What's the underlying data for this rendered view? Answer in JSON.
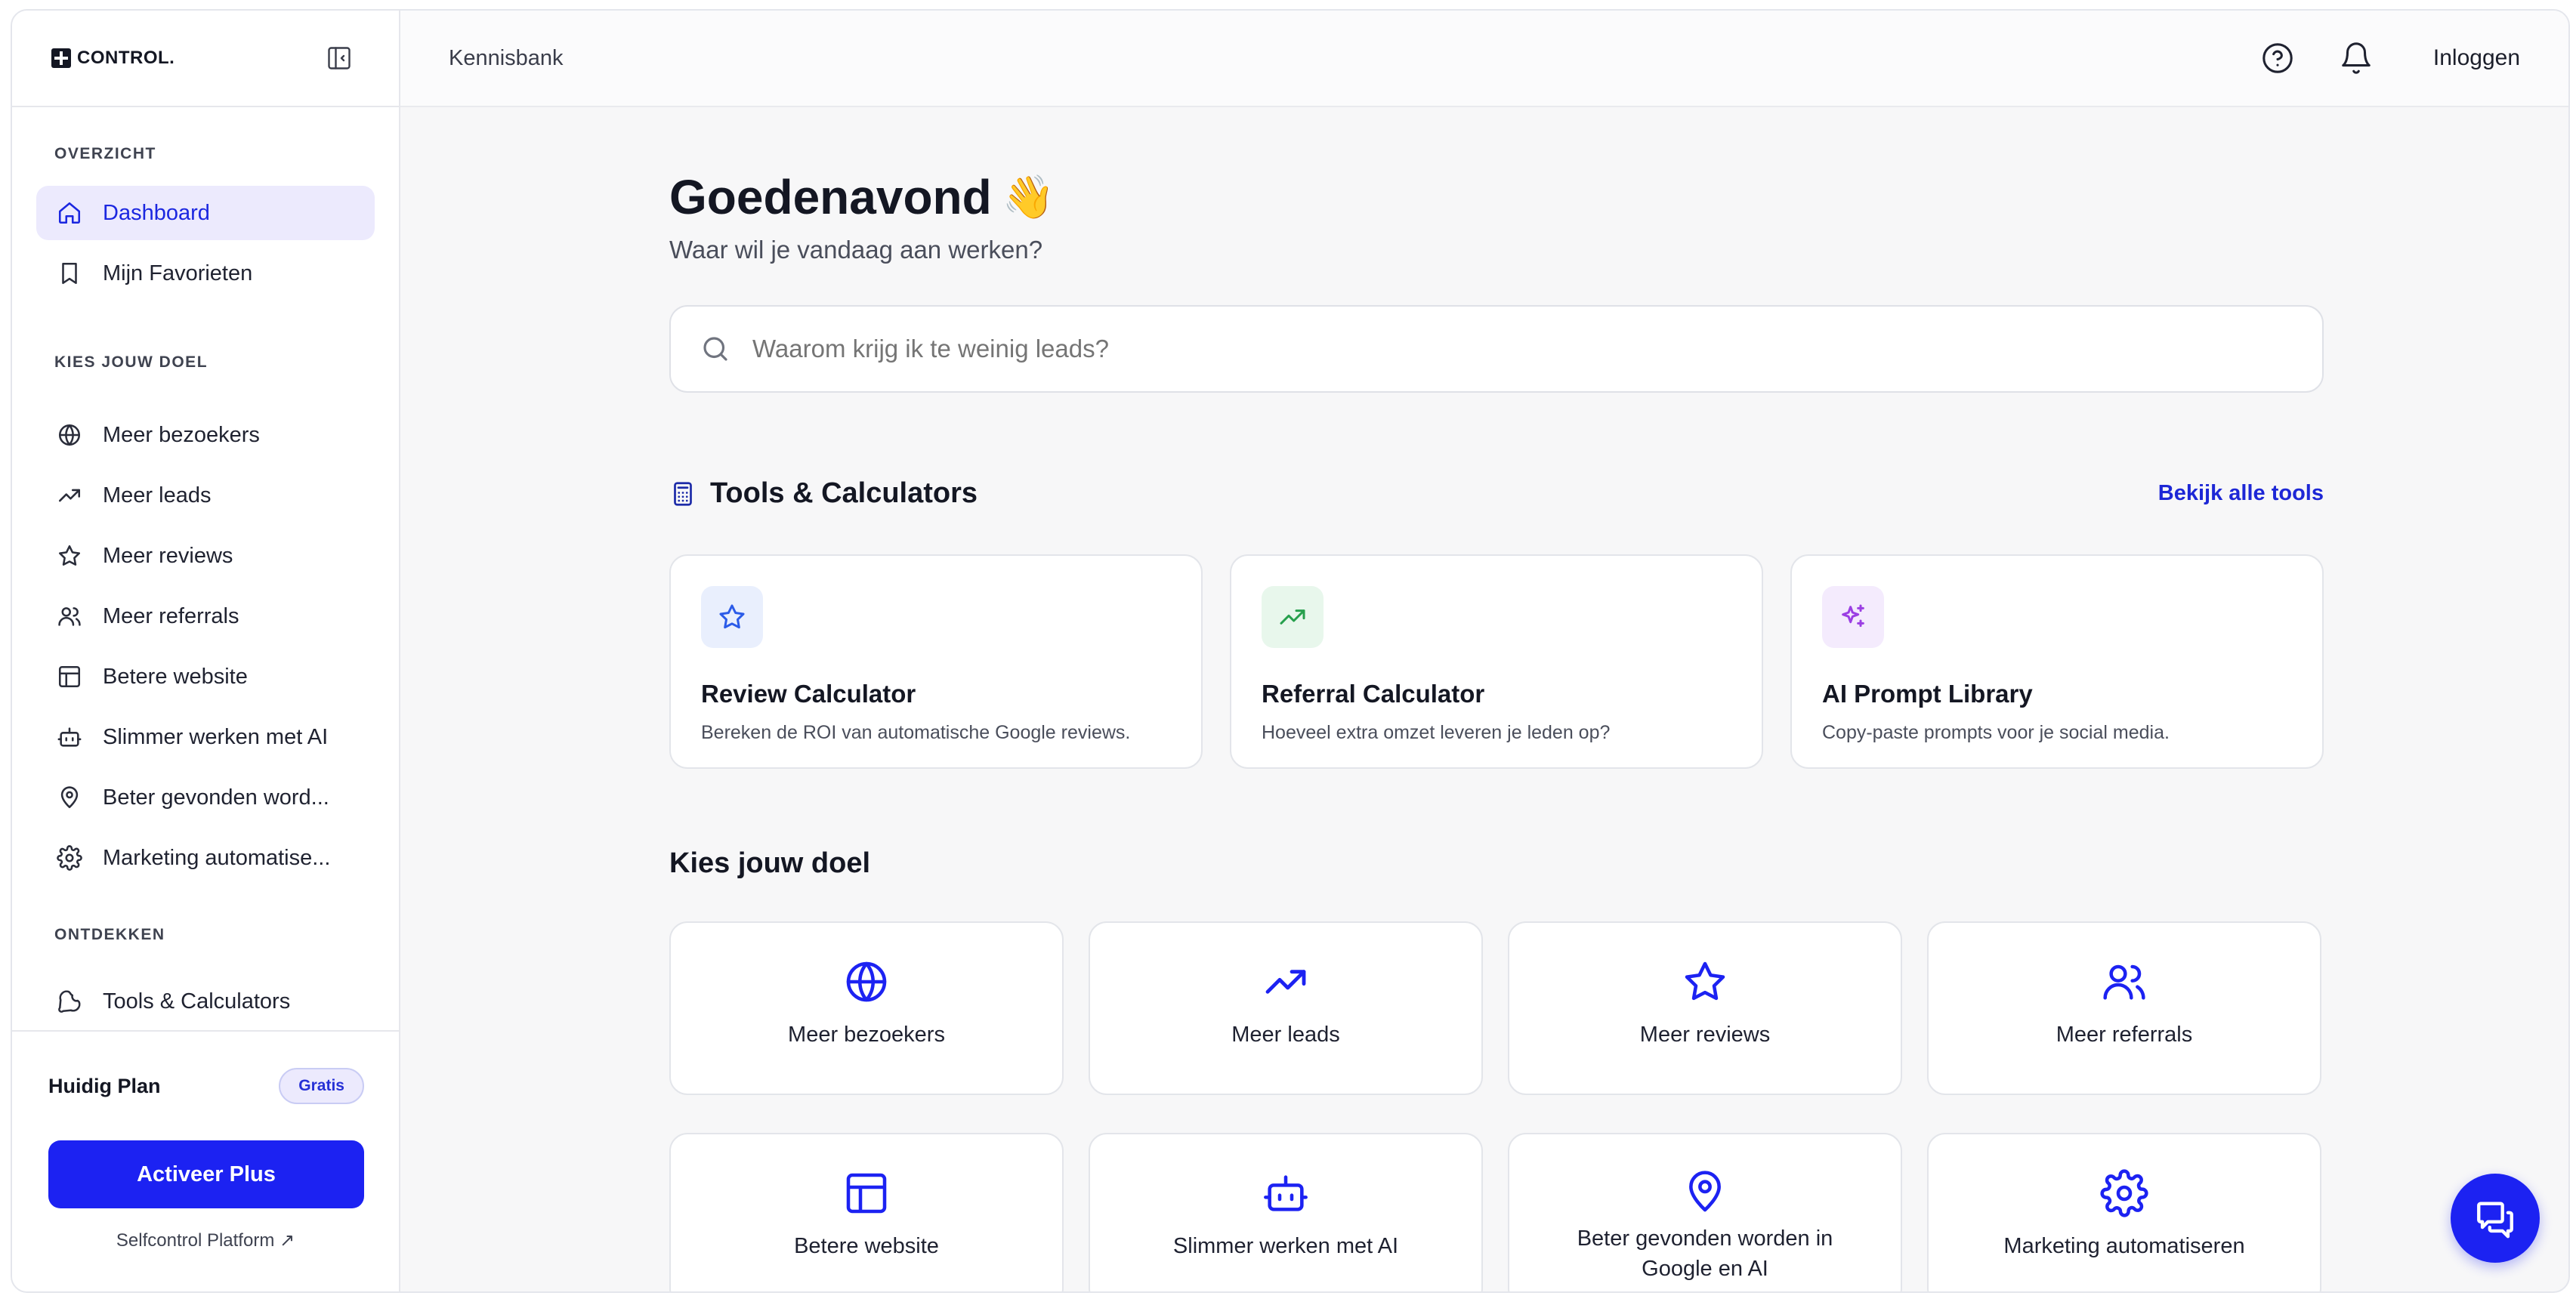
{
  "brand": {
    "name": "CONTROL."
  },
  "header": {
    "breadcrumb": "Kennisbank",
    "login_label": "Inloggen"
  },
  "sidebar": {
    "sections": {
      "overview": "OVERZICHT",
      "goals": "KIES JOUW DOEL",
      "discover": "ONTDEKKEN"
    },
    "items": {
      "dashboard": "Dashboard",
      "favorites": "Mijn Favorieten",
      "visitors": "Meer bezoekers",
      "leads": "Meer leads",
      "reviews": "Meer reviews",
      "referrals": "Meer referrals",
      "website": "Betere website",
      "ai": "Slimmer werken met AI",
      "found": "Beter gevonden word...",
      "automation": "Marketing automatise...",
      "tools": "Tools & Calculators"
    },
    "plan": {
      "label": "Huidig Plan",
      "badge": "Gratis"
    },
    "cta_label": "Activeer Plus",
    "platform_link": "Selfcontrol Platform ↗"
  },
  "main": {
    "greeting": "Goedenavond",
    "greeting_emoji": "👋",
    "subtitle": "Waar wil je vandaag aan werken?",
    "search": {
      "placeholder": "Waarom krijg ik te weinig leads?"
    },
    "tools_section": {
      "title": "Tools & Calculators",
      "see_all": "Bekijk alle tools",
      "cards": [
        {
          "title": "Review Calculator",
          "desc": "Bereken de ROI van automatische Google reviews.",
          "icon": "star-icon",
          "bg": "#e9effd",
          "color": "#2b5be8"
        },
        {
          "title": "Referral Calculator",
          "desc": "Hoeveel extra omzet leveren je leden op?",
          "icon": "trending-up-icon",
          "bg": "#e8f7ec",
          "color": "#27a04d"
        },
        {
          "title": "AI Prompt Library",
          "desc": "Copy-paste prompts voor je social media.",
          "icon": "sparkles-icon",
          "bg": "#f4ebfd",
          "color": "#9b3fe3"
        }
      ]
    },
    "goals_section": {
      "title": "Kies jouw doel",
      "cards": [
        {
          "label": "Meer bezoekers",
          "icon": "globe-icon"
        },
        {
          "label": "Meer leads",
          "icon": "trending-up-icon"
        },
        {
          "label": "Meer reviews",
          "icon": "star-icon"
        },
        {
          "label": "Meer referrals",
          "icon": "users-icon"
        },
        {
          "label": "Betere website",
          "icon": "layout-icon"
        },
        {
          "label": "Slimmer werken met AI",
          "icon": "bot-icon"
        },
        {
          "label": "Beter gevonden worden in Google en AI",
          "icon": "map-pin-icon"
        },
        {
          "label": "Marketing automatiseren",
          "icon": "gear-icon"
        }
      ]
    }
  },
  "colors": {
    "accent": "#1c22f2",
    "active_bg": "#eceafd",
    "text": "#141723"
  }
}
